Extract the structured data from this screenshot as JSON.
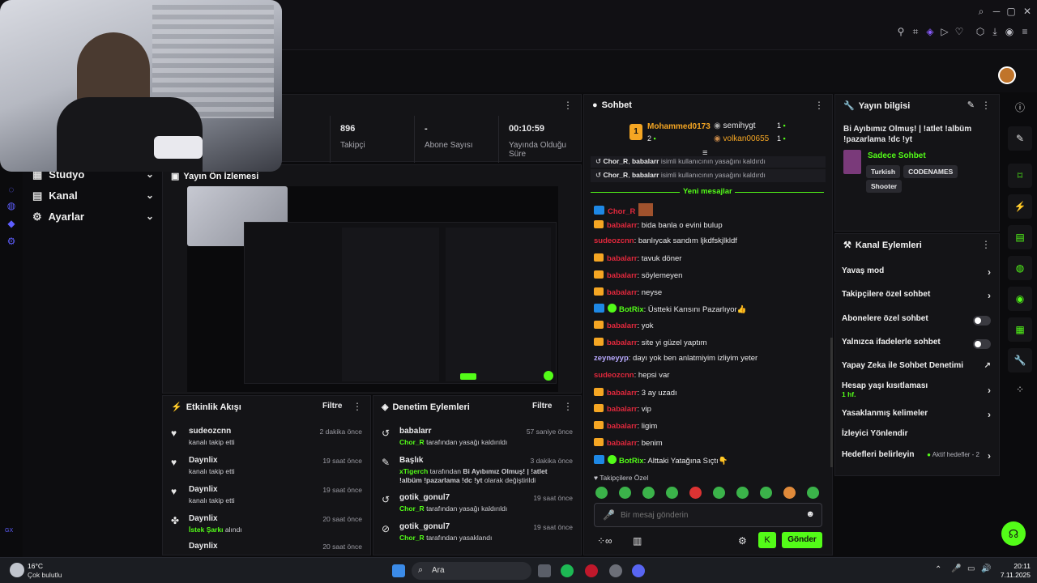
{
  "stats": [
    {
      "value": "896",
      "label": "Takipçi"
    },
    {
      "value": "-",
      "label": "Abone Sayısı"
    },
    {
      "value": "00:10:59",
      "label": "Yayında Olduğu Süre"
    }
  ],
  "nav": {
    "items": [
      {
        "label": "Stüdyo"
      },
      {
        "label": "Kanal"
      },
      {
        "label": "Ayarlar"
      }
    ]
  },
  "preview": {
    "title": "Yayın Ön İzlemesi"
  },
  "activity": {
    "title": "Etkinlik Akışı",
    "filter_label": "Filtre",
    "rows": [
      {
        "name": "sudeozcnn",
        "desc": "kanalı takip etti",
        "time": "2 dakika önce"
      },
      {
        "name": "Daynlix",
        "desc": "kanalı takip etti",
        "time": "19 saat önce"
      },
      {
        "name": "Daynlix",
        "desc": "kanalı takip etti",
        "time": "19 saat önce"
      },
      {
        "name": "Daynlix",
        "desc_highlight": "İstek Şarkı",
        "desc": "alındı",
        "time": "20 saat önce"
      },
      {
        "name": "Daynlix",
        "desc": "",
        "time": "20 saat önce"
      }
    ]
  },
  "moderation": {
    "title": "Denetim Eylemleri",
    "filter_label": "Filtre",
    "rows": [
      {
        "name": "babalarr",
        "actor": "Chor_R",
        "desc": "tarafından yasağı kaldırıldı",
        "time": "57 saniye önce"
      },
      {
        "name": "Başlık",
        "actor": "xTigerch",
        "desc_mid": "tarafından",
        "desc_bold": "Bi Ayıbımız Olmuş! | !atlet !albüm !pazarlama !dc !yt",
        "desc": "olarak değiştirildi",
        "time": "3 dakika önce"
      },
      {
        "name": "gotik_gonul7",
        "actor": "Chor_R",
        "desc": "tarafından yasağı kaldırıldı",
        "time": "19 saat önce"
      },
      {
        "name": "gotik_gonul7",
        "actor": "Chor_R",
        "desc": "tarafından yasaklandı",
        "time": "19 saat önce"
      }
    ]
  },
  "chat": {
    "title": "Sohbet",
    "top_users": [
      {
        "name": "Mohammed0173",
        "count": "2",
        "rank": "1"
      },
      {
        "name": "semihygt",
        "count": "1"
      },
      {
        "name": "volkan00655",
        "count": "1"
      }
    ],
    "system_lines": [
      {
        "actor": "Chor_R",
        "target": "babalarr",
        "text": "isimli kullanıcının yasağını kaldırdı"
      },
      {
        "actor": "Chor_R",
        "target": "babalarr",
        "text": "isimli kullanıcının yasağını kaldırdı"
      }
    ],
    "new_messages_label": "Yeni mesajlar",
    "messages": [
      {
        "user": "Chor_R",
        "badge": "mod",
        "color": "#e0283c",
        "text": ""
      },
      {
        "user": "babalarr",
        "badge": "crown",
        "color": "#e0283c",
        "text": ": bida banla o evini bulup"
      },
      {
        "user": "sudeozcnn",
        "badge": "",
        "color": "#e0283c",
        "text": ": banlıycak sandım ljkdfskjlkldf"
      },
      {
        "user": "babalarr",
        "badge": "crown",
        "color": "#e0283c",
        "text": ": tavuk döner"
      },
      {
        "user": "babalarr",
        "badge": "crown",
        "color": "#e0283c",
        "text": ": söylemeyen"
      },
      {
        "user": "babalarr",
        "badge": "crown",
        "color": "#e0283c",
        "text": ": neyse"
      },
      {
        "user": "BotRix",
        "badge": "mod-verified",
        "color": "#53fc18",
        "text": ": Üstteki Karısını Pazarlıyor👍"
      },
      {
        "user": "babalarr",
        "badge": "crown",
        "color": "#e0283c",
        "text": ": yok"
      },
      {
        "user": "babalarr",
        "badge": "crown",
        "color": "#e0283c",
        "text": ": site yi güzel yaptım"
      },
      {
        "user": "zeyneyyp",
        "badge": "",
        "color": "#b8a9ff",
        "text": ": dayı yok ben anlatmiyim izliyim yeter"
      },
      {
        "user": "sudeozcnn",
        "badge": "",
        "color": "#e0283c",
        "text": ": hepsi var"
      },
      {
        "user": "babalarr",
        "badge": "crown",
        "color": "#e0283c",
        "text": ": 3 ay uzadı"
      },
      {
        "user": "babalarr",
        "badge": "crown",
        "color": "#e0283c",
        "text": ": vip"
      },
      {
        "user": "babalarr",
        "badge": "crown",
        "color": "#e0283c",
        "text": ": ligim"
      },
      {
        "user": "babalarr",
        "badge": "crown",
        "color": "#e0283c",
        "text": ": benim"
      },
      {
        "user": "BotRix",
        "badge": "mod-verified",
        "color": "#53fc18",
        "text": ": Alttaki Yatağına Sıçtı👇"
      }
    ],
    "emote_section_label": "Takipçilere Özel",
    "input_placeholder": "Bir mesaj gönderin",
    "send_label": "Gönder"
  },
  "stream_info": {
    "title": "Yayın bilgisi",
    "stream_title": "Bi Ayıbımız Olmuş! | !atlet !albüm !pazarlama !dc !yt",
    "category": "Sadece Sohbet",
    "tags": [
      "Turkish",
      "CODENAMES",
      "Shooter"
    ]
  },
  "channel_actions": {
    "title": "Kanal Eylemleri",
    "items": [
      {
        "label": "Yavaş mod",
        "control": "chevron"
      },
      {
        "label": "Takipçilere özel sohbet",
        "control": "chevron"
      },
      {
        "label": "Abonelere özel sohbet",
        "control": "toggle"
      },
      {
        "label": "Yalnızca ifadelerle sohbet",
        "control": "toggle"
      },
      {
        "label": "Yapay Zeka ile Sohbet Denetimi",
        "control": "external"
      },
      {
        "label": "Hesap yaşı kısıtlaması",
        "sub": "1 hf.",
        "control": "chevron"
      },
      {
        "label": "Yasaklanmış kelimeler",
        "control": "chevron"
      },
      {
        "label": "İzleyici Yönlendir",
        "control": ""
      },
      {
        "label": "Hedefleri belirleyin",
        "extra": "Aktif hedefler - 2",
        "control": "chevron"
      }
    ]
  },
  "taskbar": {
    "weather_temp": "16°C",
    "weather_desc": "Çok bulutlu",
    "search_placeholder": "Ara",
    "time": "20:11",
    "date": "7.11.2025"
  },
  "left_rail": {
    "label": "GX"
  },
  "colors": {
    "accent": "#53fc18",
    "background": "#0b0b0d",
    "panel": "#141417",
    "red_user": "#e0283c",
    "badge_gold": "#f5a623"
  }
}
